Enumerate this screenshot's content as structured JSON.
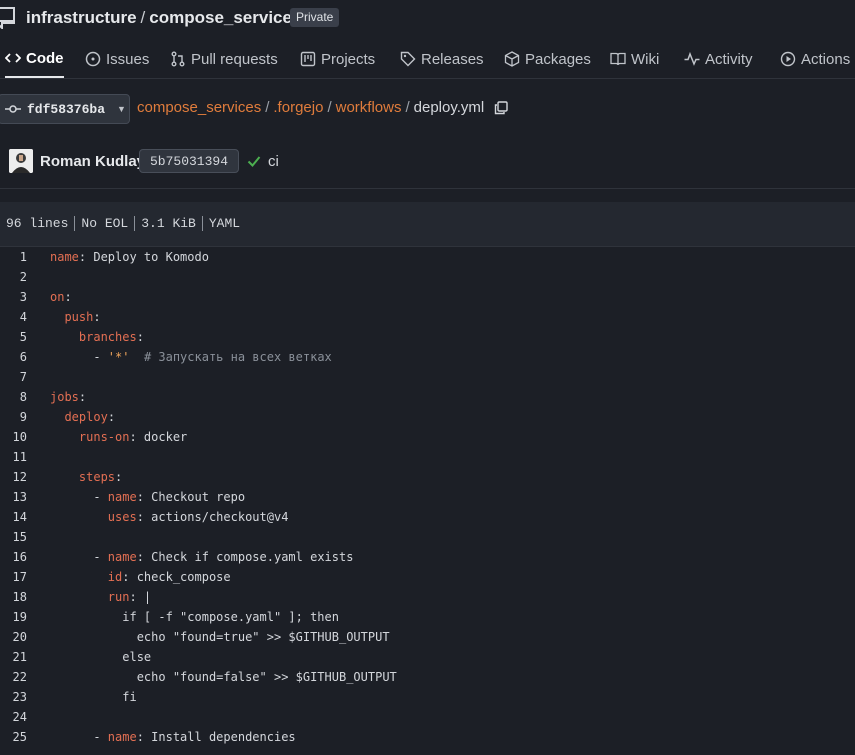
{
  "repo": {
    "owner": "infrastructure",
    "separator": "/",
    "name": "compose_services",
    "visibility": "Private",
    "icon": "repo-icon"
  },
  "tabs": [
    {
      "label": "Code",
      "icon": "code-icon",
      "active": true
    },
    {
      "label": "Issues",
      "icon": "issue-icon"
    },
    {
      "label": "Pull requests",
      "icon": "pull-request-icon"
    },
    {
      "label": "Projects",
      "icon": "project-icon"
    },
    {
      "label": "Releases",
      "icon": "tag-icon"
    },
    {
      "label": "Packages",
      "icon": "package-icon"
    },
    {
      "label": "Wiki",
      "icon": "book-icon"
    },
    {
      "label": "Activity",
      "icon": "pulse-icon"
    },
    {
      "label": "Actions",
      "icon": "play-icon"
    }
  ],
  "path": {
    "ref": "fdf58376ba",
    "segments": [
      "compose_services",
      ".forgejo",
      "workflows"
    ],
    "separator": "/",
    "file": "deploy.yml"
  },
  "commit": {
    "author": "Roman Kudlay",
    "sha": "5b75031394",
    "message": "ci",
    "status": "success"
  },
  "file_meta": [
    "96 lines",
    "No EOL",
    "3.1 KiB",
    "YAML"
  ],
  "code_lines": [
    {
      "n": "1",
      "parts": [
        [
          "k",
          "name"
        ],
        [
          "p",
          ": Deploy to Komodo"
        ]
      ]
    },
    {
      "n": "2",
      "parts": []
    },
    {
      "n": "3",
      "parts": [
        [
          "k",
          "on"
        ],
        [
          "p",
          ":"
        ]
      ]
    },
    {
      "n": "4",
      "parts": [
        [
          "p",
          "  "
        ],
        [
          "k",
          "push"
        ],
        [
          "p",
          ":"
        ]
      ]
    },
    {
      "n": "5",
      "parts": [
        [
          "p",
          "    "
        ],
        [
          "k",
          "branches"
        ],
        [
          "p",
          ":"
        ]
      ]
    },
    {
      "n": "6",
      "parts": [
        [
          "p",
          "      - "
        ],
        [
          "s",
          "'*'"
        ],
        [
          "p",
          "  "
        ],
        [
          "c",
          "# Запускать на всех ветках"
        ]
      ]
    },
    {
      "n": "7",
      "parts": []
    },
    {
      "n": "8",
      "parts": [
        [
          "k",
          "jobs"
        ],
        [
          "p",
          ":"
        ]
      ]
    },
    {
      "n": "9",
      "parts": [
        [
          "p",
          "  "
        ],
        [
          "k",
          "deploy"
        ],
        [
          "p",
          ":"
        ]
      ]
    },
    {
      "n": "10",
      "parts": [
        [
          "p",
          "    "
        ],
        [
          "k",
          "runs-on"
        ],
        [
          "p",
          ": docker"
        ]
      ]
    },
    {
      "n": "11",
      "parts": []
    },
    {
      "n": "12",
      "parts": [
        [
          "p",
          "    "
        ],
        [
          "k",
          "steps"
        ],
        [
          "p",
          ":"
        ]
      ]
    },
    {
      "n": "13",
      "parts": [
        [
          "p",
          "      - "
        ],
        [
          "k",
          "name"
        ],
        [
          "p",
          ": Checkout repo"
        ]
      ]
    },
    {
      "n": "14",
      "parts": [
        [
          "p",
          "        "
        ],
        [
          "k",
          "uses"
        ],
        [
          "p",
          ": actions/checkout@v4"
        ]
      ]
    },
    {
      "n": "15",
      "parts": []
    },
    {
      "n": "16",
      "parts": [
        [
          "p",
          "      - "
        ],
        [
          "k",
          "name"
        ],
        [
          "p",
          ": Check if compose.yaml exists"
        ]
      ]
    },
    {
      "n": "17",
      "parts": [
        [
          "p",
          "        "
        ],
        [
          "k",
          "id"
        ],
        [
          "p",
          ": check_compose"
        ]
      ]
    },
    {
      "n": "18",
      "parts": [
        [
          "p",
          "        "
        ],
        [
          "k",
          "run"
        ],
        [
          "p",
          ": |"
        ]
      ]
    },
    {
      "n": "19",
      "parts": [
        [
          "p",
          "          if [ -f \"compose.yaml\" ]; then"
        ]
      ]
    },
    {
      "n": "20",
      "parts": [
        [
          "p",
          "            echo \"found=true\" >> $GITHUB_OUTPUT"
        ]
      ]
    },
    {
      "n": "21",
      "parts": [
        [
          "p",
          "          else"
        ]
      ]
    },
    {
      "n": "22",
      "parts": [
        [
          "p",
          "            echo \"found=false\" >> $GITHUB_OUTPUT"
        ]
      ]
    },
    {
      "n": "23",
      "parts": [
        [
          "p",
          "          fi"
        ]
      ]
    },
    {
      "n": "24",
      "parts": []
    },
    {
      "n": "25",
      "parts": [
        [
          "p",
          "      - "
        ],
        [
          "k",
          "name"
        ],
        [
          "p",
          ": Install dependencies"
        ]
      ]
    }
  ],
  "colors": {
    "background": "#1c1f26",
    "accent_link": "#e07c3c",
    "yaml_key": "#e36f53",
    "yaml_string": "#f0a55c",
    "comment": "#8a9099",
    "success": "#4caf50"
  }
}
